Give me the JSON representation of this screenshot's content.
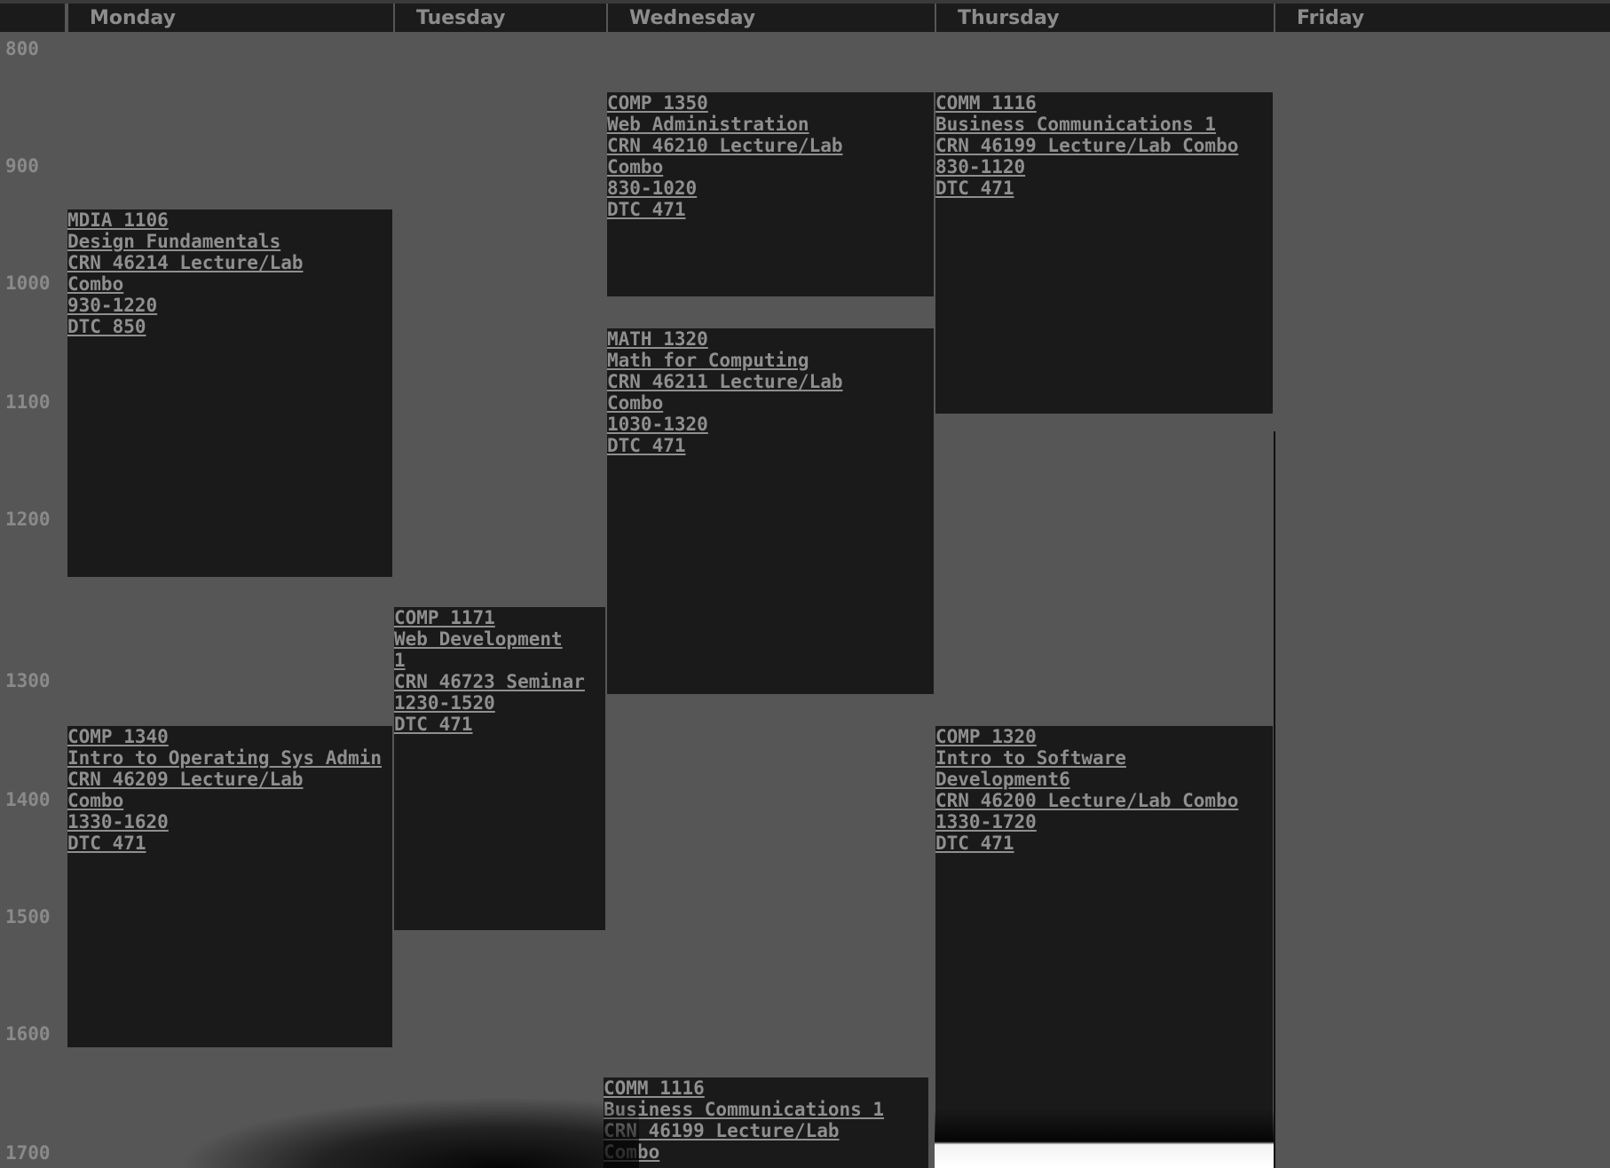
{
  "days": [
    "Monday",
    "Tuesday",
    "Wednesday",
    "Thursday",
    "Friday"
  ],
  "times": [
    "800",
    "900",
    "1000",
    "1100",
    "1200",
    "1300",
    "1400",
    "1500",
    "1600",
    "1700"
  ],
  "events": [
    {
      "day": "Wednesday",
      "lines": [
        "COMP 1350",
        "Web Administration",
        "CRN 46210 Lecture/Lab",
        "Combo",
        "830-1020",
        "DTC 471"
      ]
    },
    {
      "day": "Thursday",
      "lines": [
        "COMM 1116",
        "Business Communications 1",
        "CRN 46199 Lecture/Lab Combo",
        "830-1120",
        "DTC 471"
      ]
    },
    {
      "day": "Monday",
      "lines": [
        "MDIA 1106",
        "Design Fundamentals",
        "CRN 46214 Lecture/Lab",
        "Combo",
        "930-1220",
        "DTC 850"
      ]
    },
    {
      "day": "Wednesday",
      "lines": [
        "MATH 1320",
        "Math for Computing",
        "CRN 46211 Lecture/Lab",
        "Combo",
        "1030-1320",
        "DTC 471"
      ]
    },
    {
      "day": "Tuesday",
      "lines": [
        "COMP 1171",
        "Web Development",
        "1",
        "CRN 46723 Seminar",
        "1230-1520",
        "DTC 471"
      ]
    },
    {
      "day": "Monday",
      "lines": [
        "COMP 1340",
        "Intro to Operating Sys Admin",
        "CRN 46209 Lecture/Lab",
        "Combo",
        "1330-1620",
        "DTC 471"
      ]
    },
    {
      "day": "Thursday",
      "lines": [
        "COMP 1320",
        "Intro to Software",
        "Development6",
        "CRN 46200 Lecture/Lab Combo",
        "1330-1720",
        "DTC 471"
      ]
    },
    {
      "day": "Wednesday",
      "lines": [
        "COMM 1116",
        "Business Communications 1",
        "CRN 46199 Lecture/Lab",
        "Combo"
      ]
    }
  ]
}
